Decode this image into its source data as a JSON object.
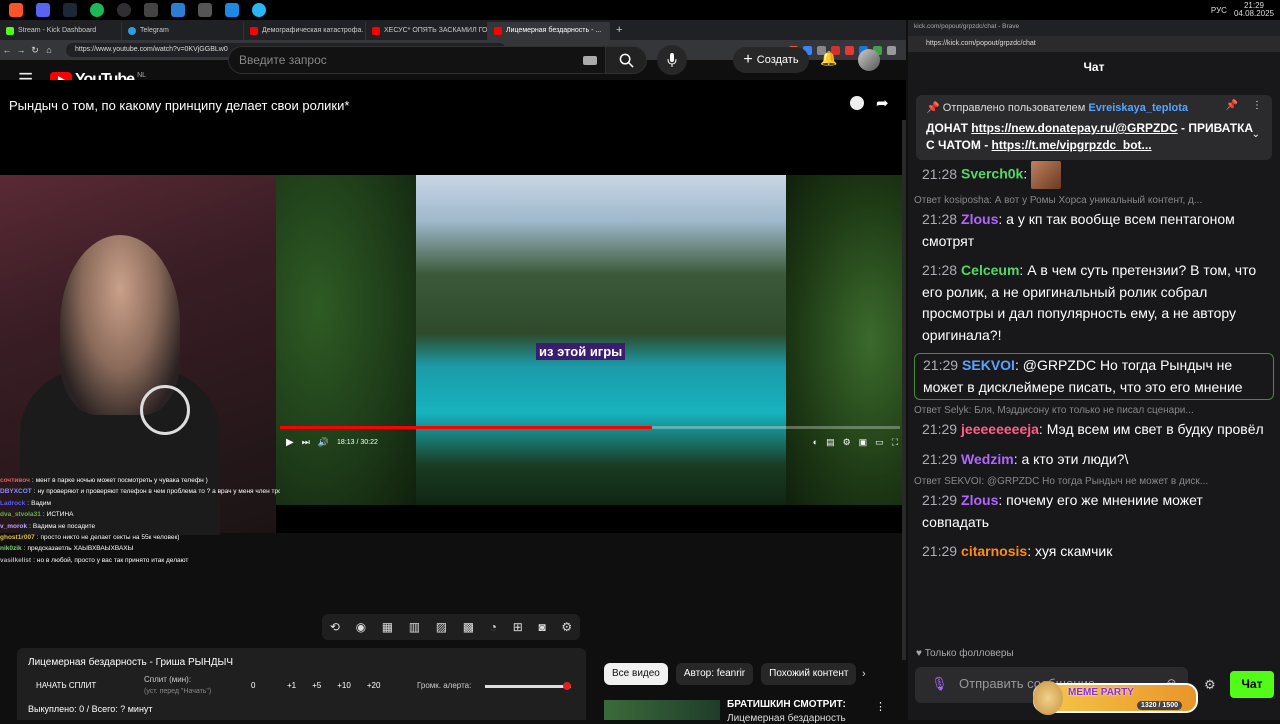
{
  "taskbar": {
    "icons": [
      "brave-icon",
      "discord-icon",
      "steam-icon",
      "spotify-icon",
      "obs-icon",
      "app-icon",
      "app2-icon",
      "tool-icon",
      "tool2-icon",
      "tool3-icon"
    ],
    "lang": "РУС",
    "time": "21:29",
    "date": "04.08.2025"
  },
  "browser_tabs": [
    {
      "label": "Stream - Kick Dashboard",
      "color": "#53fc18"
    },
    {
      "label": "Telegram",
      "color": "#2aa1da"
    },
    {
      "label": "Демографическая катастрофа. Що...",
      "color": "#f00"
    },
    {
      "label": "ХЕСУС* ОПЯТЬ ЗАСКАМИЛ ГОЕВ Н...",
      "color": "#f00"
    },
    {
      "label": "Лицемерная бездарность - ...",
      "color": "#f00"
    }
  ],
  "address": "https://www.youtube.com/watch?v=0KVjGGBLw0",
  "yt": {
    "logo": "YouTube",
    "region": "NL",
    "search_placeholder": "Введите запрос",
    "create": "Создать"
  },
  "video": {
    "title": "Рындыч о том, по какому принципу делает свои ролики*",
    "caption": "из этой игры",
    "time": "18:13 / 30:22",
    "progress": 0.6
  },
  "overlay_chat": [
    {
      "user": "сочтивоч",
      "color": "#e06060",
      "text": "мент в парке ночью может посмотреть у чувака телефн )"
    },
    {
      "user": "DBYXCOT",
      "color": "#8a8aff",
      "text": "ну проверяют и проверяют телефон в чем проблема то ? а врач у меня член трогал и не умер"
    },
    {
      "user": "Ladrock",
      "color": "#5a5aff",
      "text": "Вадим"
    },
    {
      "user": "dva_stvola31",
      "color": "#6ab04c",
      "text": "ИСТИНА"
    },
    {
      "user": "v_morok",
      "color": "#c0a0ff",
      "text": "Вадима не посадите"
    },
    {
      "user": "ghost1r007",
      "color": "#e0c040",
      "text": "просто никто не делает секты на 55к человек)"
    },
    {
      "user": "nik0zik",
      "color": "#7ad07a",
      "text": "предсказаетль ХАЫВХВАЫХВАХЫ"
    },
    {
      "user": "vasilkelist",
      "color": "#aaa",
      "text": "но в любой, просто у вас так принято итак делают"
    }
  ],
  "timer": {
    "title": "Лицемерная бездарность - Гриша РЫНДЫЧ",
    "start": "НАЧАТЬ СПЛИТ",
    "split_label": "Сплит (мин):",
    "split_hint": "(уст. перед \"Начать\")",
    "zero": "0",
    "increments": [
      "+1",
      "+5",
      "+10",
      "+20"
    ],
    "alert_label": "Громк. алерта:",
    "alert_level": 0.95,
    "bought": "Выкуплено: 0 / Всего: ? минут"
  },
  "filters": [
    "Все видео",
    "Автор: feanrir",
    "Похожий контент"
  ],
  "recommendation": {
    "title": "БРАТИШКИН СМОТРИТ:",
    "subtitle": "Лицемерная бездарность"
  },
  "kick": {
    "tab": "kick.com/popout/grpzdc/chat - Brave",
    "address": "https://kick.com/popout/grpzdc/chat",
    "header": "Чат",
    "pinned": {
      "prefix": "Отправлено пользователем",
      "user": "Evreiskaya_teplota",
      "text1": "ДОНАТ",
      "link1": "https://new.donatepay.ru/@GRPZDC",
      "text2": "- ПРИВАТКА С ЧАТОМ -",
      "link2": "https://t.me/vipgrpzdc_bot..."
    },
    "messages": [
      {
        "reply": "",
        "time": "21:28",
        "user": "Sverch0k",
        "color": "#53d769",
        "text": "",
        "emote": true,
        "hl": false
      },
      {
        "reply": "Ответ kosiposha: А вот у Ромы Хорса уникальный контент, д...",
        "time": "21:28",
        "user": "Zlous",
        "color": "#b266ff",
        "text": "а у кп так вообще всем пентагоном смотрят",
        "emote": false,
        "hl": false
      },
      {
        "reply": "",
        "time": "21:28",
        "user": "Celceum",
        "color": "#53d769",
        "text": "А в чем суть претензии? В том, что его ролик, а не оригинальный ролик собрал просмотры и дал популярность ему, а не автору оригинала?!",
        "emote": false,
        "hl": false
      },
      {
        "reply": "",
        "time": "21:29",
        "user": "SEKVOI",
        "color": "#56a4ff",
        "text": "@GRPZDC Но тогда Рындыч не может в дисклеймере писать, что это его мнение",
        "emote": false,
        "hl": true
      },
      {
        "reply": "Ответ Selyk: Бля, Мэддисону кто только не писал сценари...",
        "time": "21:29",
        "user": "jeeeeeeeeja",
        "color": "#ff5f8a",
        "text": "Мэд всем им свет в будку провёл",
        "emote": false,
        "hl": false
      },
      {
        "reply": "",
        "time": "21:29",
        "user": "Wedzim",
        "color": "#b266ff",
        "text": "а кто эти люди?\\",
        "emote": false,
        "hl": false
      },
      {
        "reply": "Ответ SEKVOI: @GRPZDC Но тогда Рындыч не может в диск...",
        "time": "21:29",
        "user": "Zlous",
        "color": "#b266ff",
        "text": "почему его же мнениие может совпадать",
        "emote": false,
        "hl": false
      },
      {
        "reply": "",
        "time": "21:29",
        "user": "citarnosis",
        "color": "#ff8c1a",
        "text": "хуя скамчик",
        "emote": false,
        "hl": false
      }
    ],
    "followers": "Только фолловеры",
    "input_placeholder": "Отправить сообщение...",
    "send": "Чат",
    "meme": {
      "title": "MEME PARTY",
      "count": "1320 / 1500"
    }
  }
}
